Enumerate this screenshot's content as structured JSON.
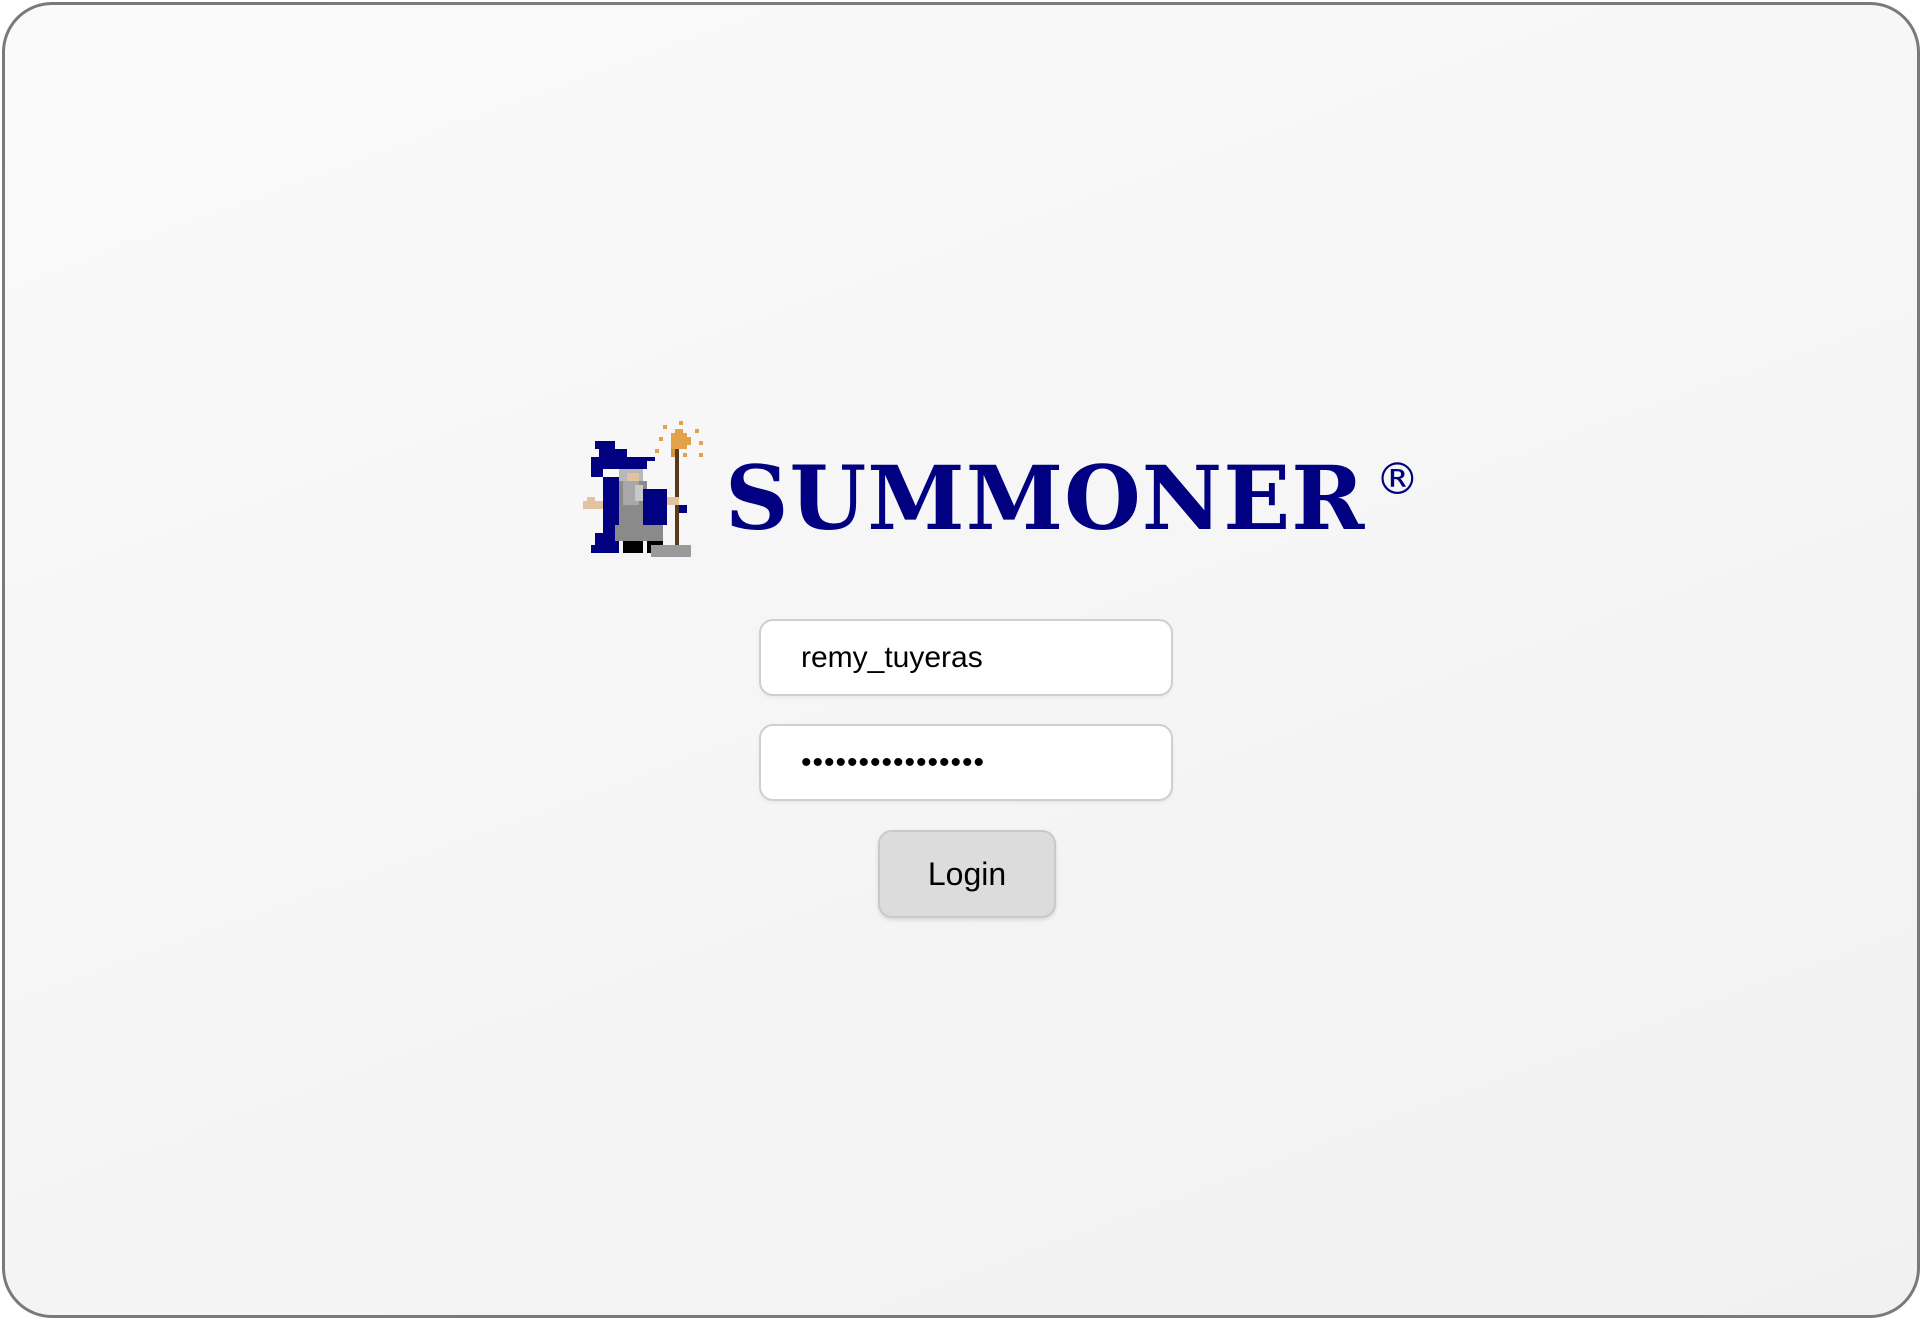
{
  "brand": {
    "name": "SUMMONER",
    "registered_mark": "®",
    "color": "#000080",
    "icon": "wizard-logo-icon"
  },
  "login_form": {
    "username_value": "remy_tuyeras",
    "password_value": "password12345678",
    "login_label": "Login"
  }
}
